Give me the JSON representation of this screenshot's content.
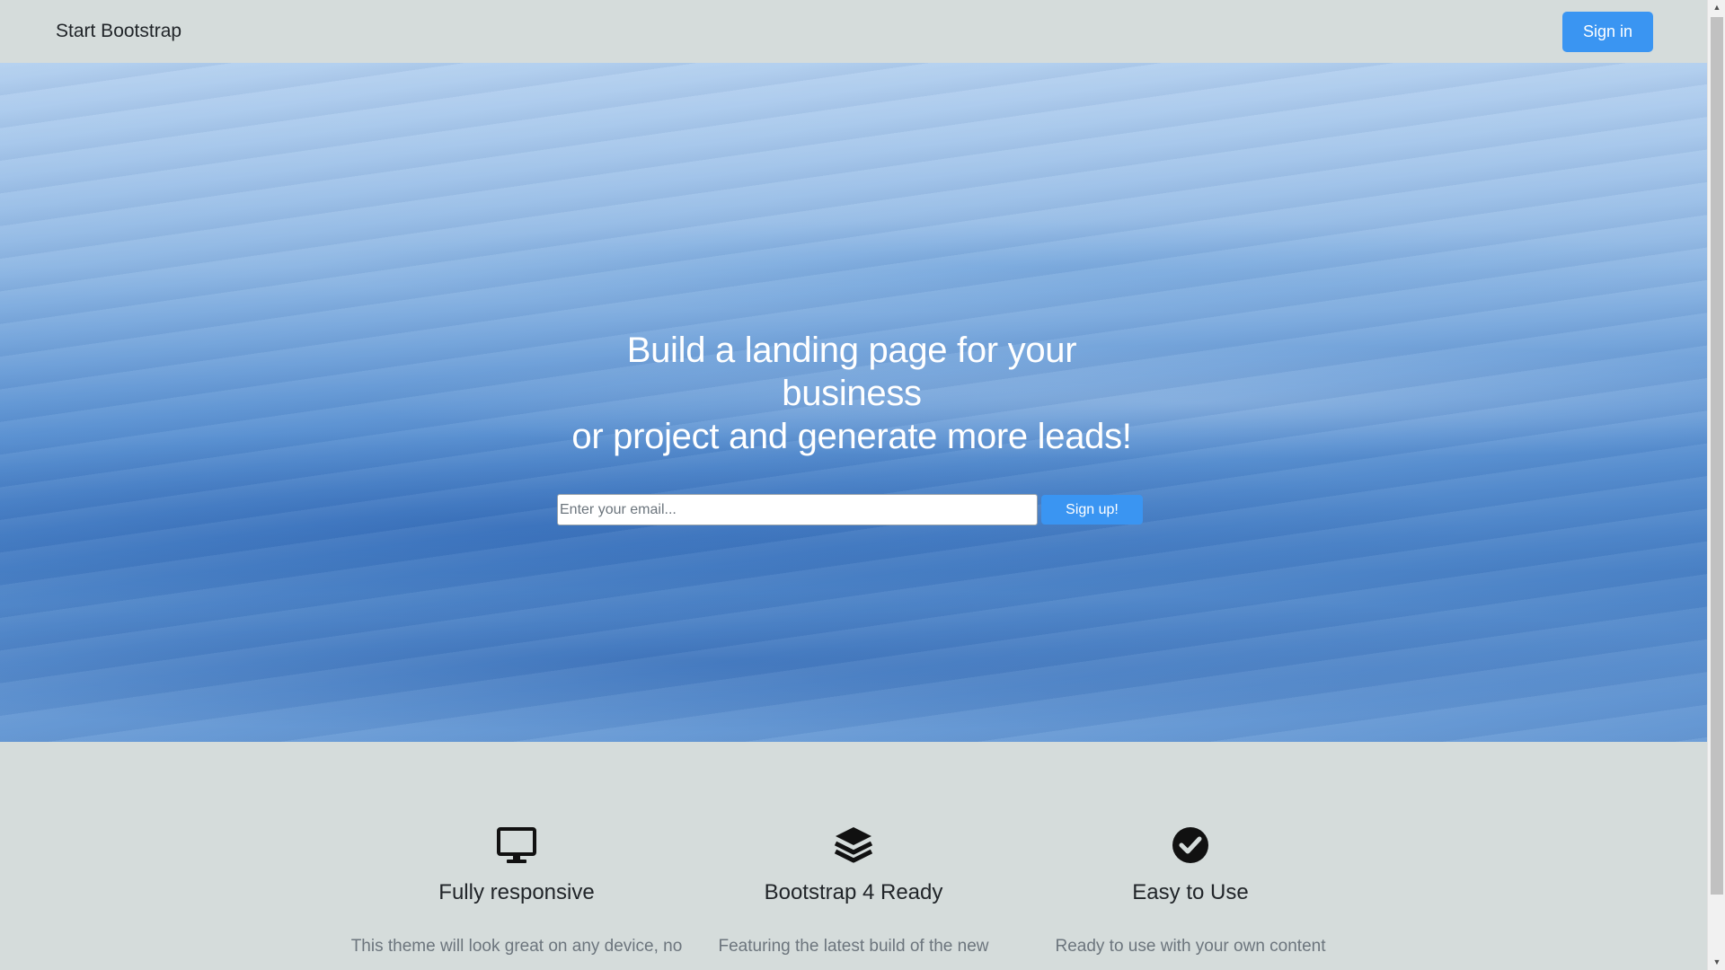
{
  "navbar": {
    "brand": "Start Bootstrap",
    "signin_label": "Sign in"
  },
  "hero": {
    "title_line1": "Build a landing page for your business",
    "title_line2": "or project and generate more leads!",
    "email_placeholder": "Enter your email...",
    "signup_label": "Sign up!"
  },
  "features": [
    {
      "icon": "desktop-icon",
      "title": "Fully responsive",
      "text": "This theme will look great on any device, no"
    },
    {
      "icon": "layers-icon",
      "title": "Bootstrap 4 Ready",
      "text": "Featuring the latest build of the new"
    },
    {
      "icon": "check-circle-icon",
      "title": "Easy to Use",
      "text": "Ready to use with your own content"
    }
  ],
  "colors": {
    "accent": "#3a95f2",
    "background": "#d5dcdb"
  },
  "scrollbar": {
    "up_arrow": "▲",
    "down_arrow": "▼"
  }
}
